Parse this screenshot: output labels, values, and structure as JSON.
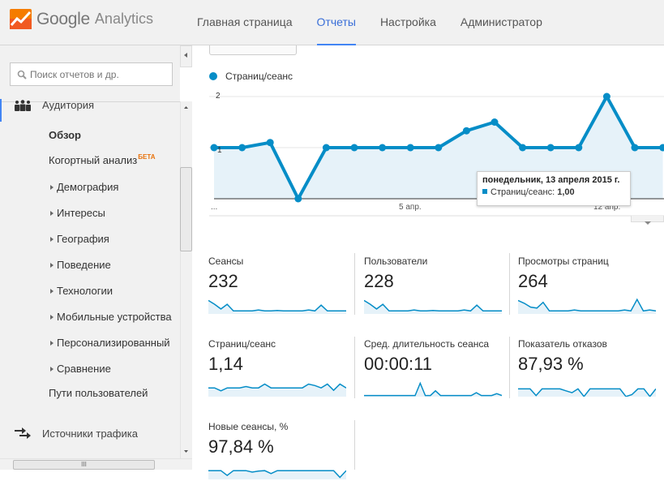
{
  "app": {
    "logo_brand": "Google",
    "logo_product": "Analytics"
  },
  "nav": {
    "tabs": [
      {
        "label": "Главная страница",
        "active": false
      },
      {
        "label": "Отчеты",
        "active": true
      },
      {
        "label": "Настройка",
        "active": false
      },
      {
        "label": "Администратор",
        "active": false
      }
    ]
  },
  "sidebar": {
    "search_placeholder": "Поиск отчетов и др.",
    "audience": {
      "label": "Аудитория",
      "icon": "people-icon"
    },
    "overview": "Обзор",
    "cohort": {
      "label": "Когортный анализ",
      "badge": "БЕТА"
    },
    "items": [
      "Демография",
      "Интересы",
      "География",
      "Поведение",
      "Технологии",
      "Мобильные устройства",
      "Персонализированный",
      "Сравнение"
    ],
    "user_flow": "Пути пользователей",
    "traffic": {
      "label": "Источники трафика",
      "icon": "traffic-arrows-icon"
    }
  },
  "chart_data": {
    "type": "line",
    "legend": "Страниц/сеанс",
    "series": [
      {
        "name": "Страниц/сеанс",
        "color": "#058dc7",
        "values": [
          1,
          1,
          1.1,
          0,
          1,
          1,
          1,
          1,
          1,
          1.33,
          1.5,
          1,
          1,
          1,
          2,
          1,
          1
        ]
      }
    ],
    "y_ticks": [
      "2",
      "1"
    ],
    "ylim": [
      0,
      2
    ],
    "x_ticks": [
      "...",
      "5 апр.",
      "12 апр."
    ],
    "x_tick_index": [
      0,
      7,
      14
    ],
    "grid": true,
    "tooltip": {
      "title": "понедельник, 13 апреля 2015 г.",
      "label": "Страниц/сеанс:",
      "value": "1,00"
    }
  },
  "metrics": [
    {
      "label": "Сеансы",
      "value": "232",
      "spark": [
        30,
        22,
        12,
        22,
        8,
        8,
        8,
        8,
        10,
        8,
        8,
        9,
        8,
        8,
        8,
        8,
        10,
        8,
        20,
        8,
        8,
        8,
        8
      ]
    },
    {
      "label": "Пользователи",
      "value": "228",
      "spark": [
        30,
        22,
        12,
        22,
        8,
        8,
        8,
        8,
        10,
        8,
        8,
        9,
        8,
        8,
        8,
        8,
        10,
        8,
        20,
        8,
        8,
        8,
        8
      ]
    },
    {
      "label": "Просмотры страниц",
      "value": "264",
      "spark": [
        30,
        24,
        16,
        14,
        26,
        8,
        8,
        8,
        8,
        10,
        8,
        8,
        8,
        8,
        8,
        8,
        8,
        10,
        8,
        32,
        8,
        10,
        8
      ]
    },
    {
      "label": "Страниц/сеанс",
      "value": "1,14",
      "spark": [
        20,
        20,
        14,
        20,
        20,
        20,
        23,
        20,
        20,
        28,
        20,
        20,
        20,
        20,
        20,
        20,
        28,
        25,
        20,
        28,
        15,
        28,
        20
      ]
    },
    {
      "label": "Сред. длительность сеанса",
      "value": "00:00:11",
      "spark": [
        4,
        4,
        4,
        4,
        4,
        4,
        4,
        4,
        4,
        4,
        4,
        30,
        4,
        4,
        14,
        4,
        4,
        4,
        4,
        4,
        4,
        4,
        10,
        4,
        4,
        4,
        8,
        4
      ]
    },
    {
      "label": "Показатель отказов",
      "value": "87,93 %",
      "spark": [
        18,
        18,
        18,
        4,
        18,
        18,
        18,
        18,
        14,
        10,
        18,
        2,
        18,
        18,
        18,
        18,
        18,
        18,
        2,
        6,
        18,
        18,
        2,
        18
      ]
    },
    {
      "label": "Новые сеансы, %",
      "value": "97,84 %",
      "spark": [
        20,
        20,
        20,
        10,
        20,
        20,
        20,
        17,
        19,
        20,
        14,
        20,
        20,
        20,
        20,
        20,
        20,
        20,
        20,
        20,
        20,
        6,
        20
      ]
    }
  ]
}
